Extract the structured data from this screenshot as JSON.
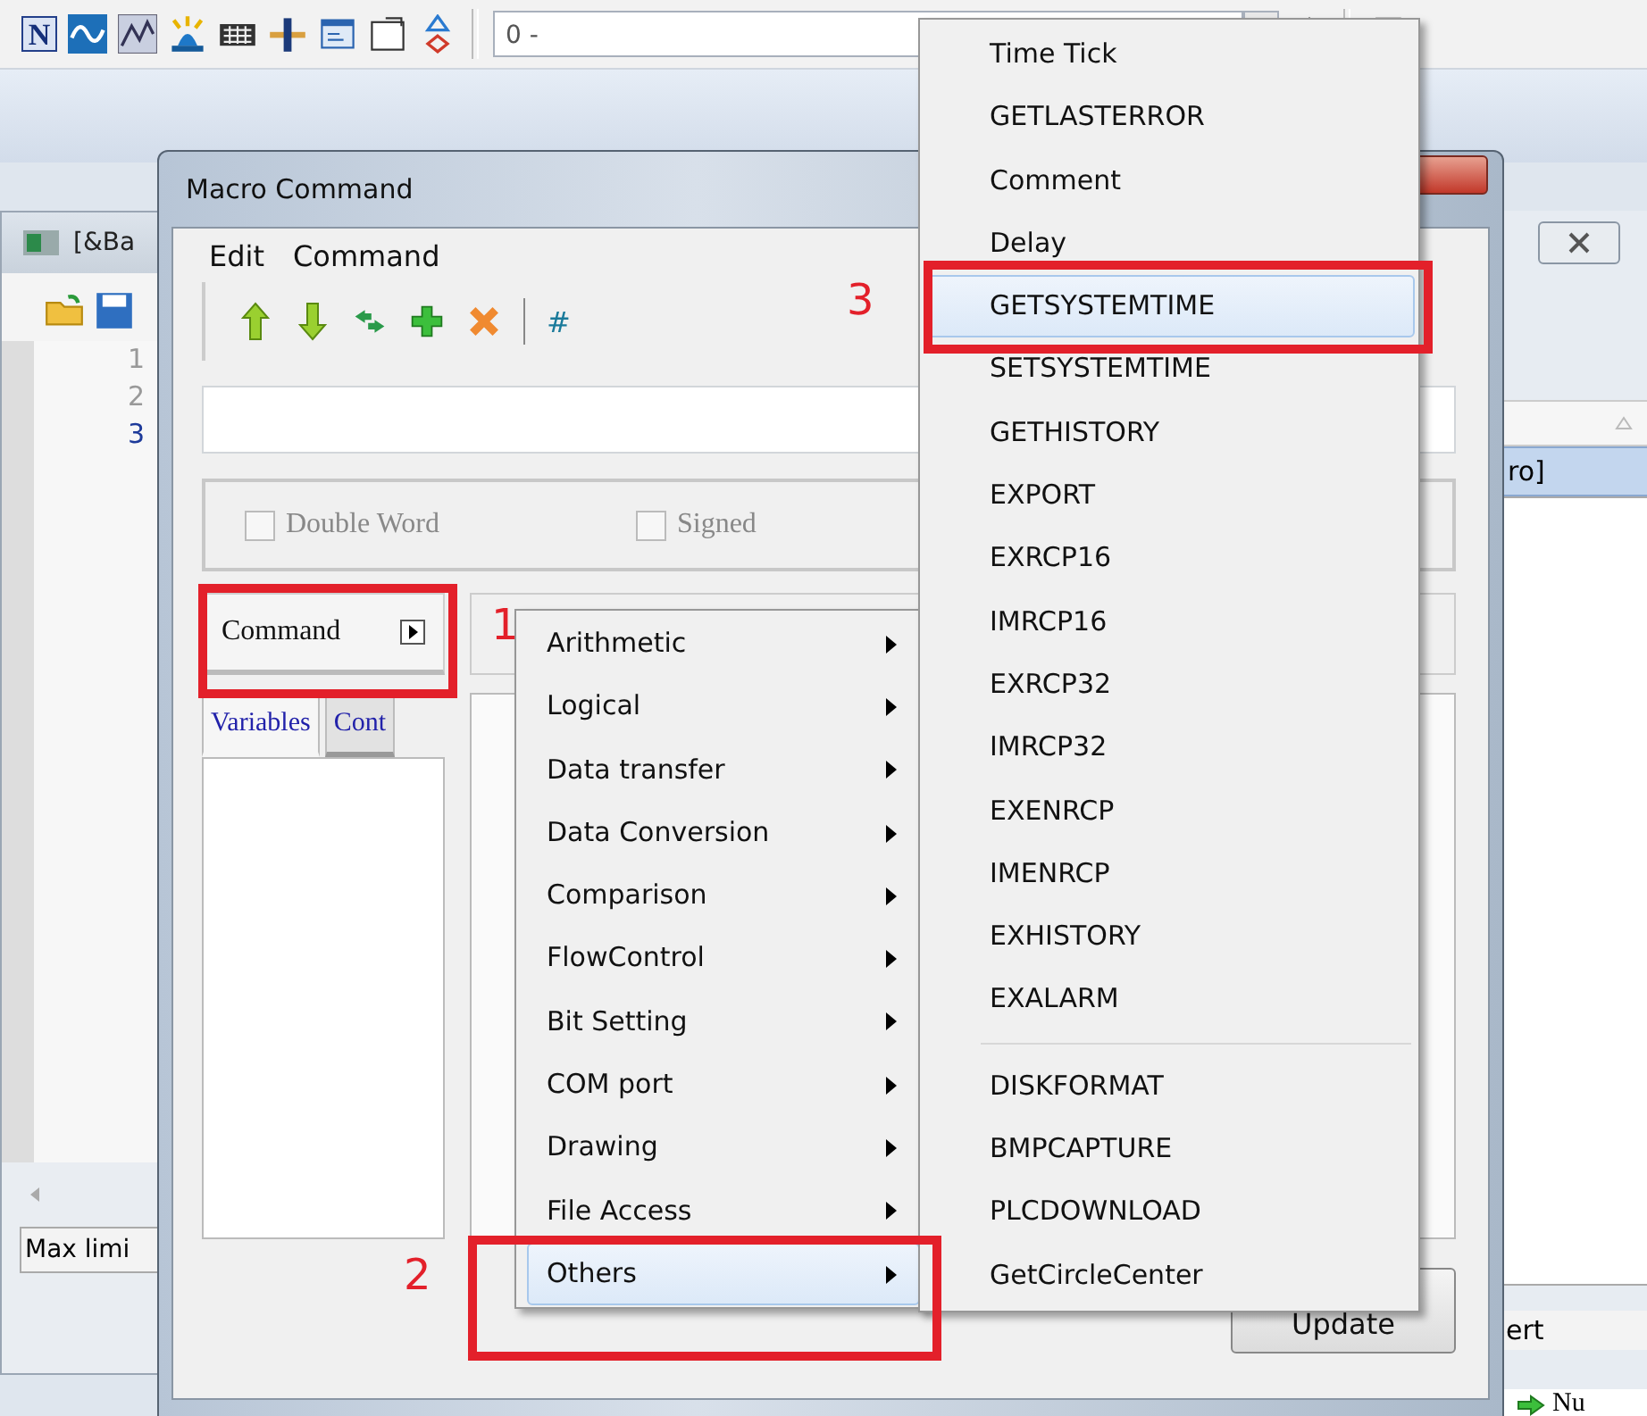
{
  "toolbar": {
    "letter_button": "N",
    "combo_value": "0 -"
  },
  "left_window": {
    "title": "[&Ba",
    "line_numbers": [
      {
        "text": "1",
        "selected": false
      },
      {
        "text": "2",
        "selected": false
      },
      {
        "text": "3",
        "selected": true
      }
    ],
    "status": "Max limi"
  },
  "right_window": {
    "selected_row": "ro]",
    "status": "ert",
    "tree_item": "Nu"
  },
  "dialog": {
    "title": "Macro Command",
    "menu": [
      "Edit",
      "Command"
    ],
    "hash_button": "#",
    "checkboxes": [
      {
        "label": "Double Word",
        "checked": false,
        "disabled": true
      },
      {
        "label": "Signed",
        "checked": false,
        "disabled": true
      }
    ],
    "command_button": "Command",
    "tabs": [
      {
        "label": "Variables",
        "selected": true
      },
      {
        "label": "Cont",
        "selected": false
      }
    ],
    "update_button": "Update"
  },
  "menu": {
    "items": [
      {
        "label": "Arithmetic",
        "selected": false
      },
      {
        "label": "Logical",
        "selected": false
      },
      {
        "label": "Data transfer",
        "selected": false
      },
      {
        "label": "Data Conversion",
        "selected": false
      },
      {
        "label": "Comparison",
        "selected": false
      },
      {
        "label": "FlowControl",
        "selected": false
      },
      {
        "label": "Bit Setting",
        "selected": false
      },
      {
        "label": "COM port",
        "selected": false
      },
      {
        "label": "Drawing",
        "selected": false
      },
      {
        "label": "File Access",
        "selected": false
      },
      {
        "label": "Others",
        "selected": true
      }
    ]
  },
  "submenu": {
    "items": [
      {
        "label": "Time Tick",
        "selected": false
      },
      {
        "label": "GETLASTERROR",
        "selected": false
      },
      {
        "label": "Comment",
        "selected": false
      },
      {
        "label": "Delay",
        "selected": false
      },
      {
        "label": "GETSYSTEMTIME",
        "selected": true
      },
      {
        "label": "SETSYSTEMTIME",
        "selected": false
      },
      {
        "label": "GETHISTORY",
        "selected": false
      },
      {
        "label": "EXPORT",
        "selected": false
      },
      {
        "label": "EXRCP16",
        "selected": false
      },
      {
        "label": "IMRCP16",
        "selected": false
      },
      {
        "label": "EXRCP32",
        "selected": false
      },
      {
        "label": "IMRCP32",
        "selected": false
      },
      {
        "label": "EXENRCP",
        "selected": false
      },
      {
        "label": "IMENRCP",
        "selected": false
      },
      {
        "label": "EXHISTORY",
        "selected": false
      },
      {
        "label": "EXALARM",
        "selected": false
      }
    ],
    "more_items": [
      {
        "label": "DISKFORMAT",
        "selected": false
      },
      {
        "label": "BMPCAPTURE",
        "selected": false
      },
      {
        "label": "PLCDOWNLOAD",
        "selected": false
      },
      {
        "label": "GetCircleCenter",
        "selected": false
      }
    ]
  },
  "callouts": [
    "1",
    "2",
    "3"
  ]
}
